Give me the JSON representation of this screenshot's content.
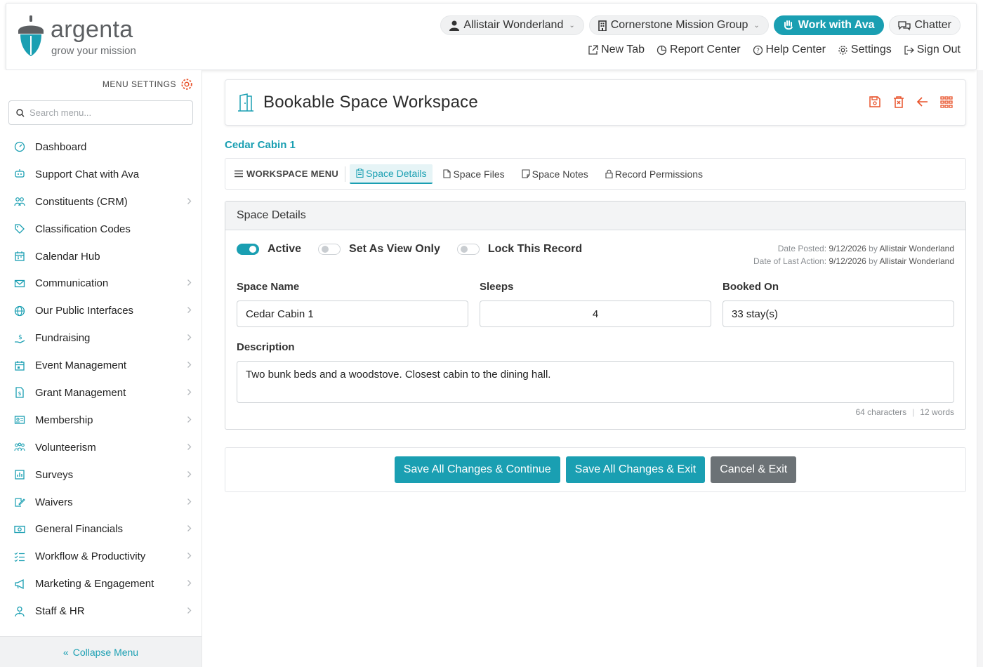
{
  "brand": {
    "name": "argenta",
    "tagline": "grow your mission",
    "accent": "#1a9fb2",
    "danger": "#e8532b"
  },
  "header": {
    "user": "Allistair Wonderland",
    "organization": "Cornerstone Mission Group",
    "ava_button": "Work with Ava",
    "chatter": "Chatter",
    "links": {
      "new_tab": "New Tab",
      "report_center": "Report Center",
      "help_center": "Help Center",
      "settings": "Settings",
      "sign_out": "Sign Out"
    }
  },
  "sidebar": {
    "menu_settings": "MENU SETTINGS",
    "search_placeholder": "Search menu...",
    "collapse": "Collapse Menu",
    "items": [
      {
        "label": "Dashboard",
        "icon": "dashboard-icon",
        "chevron": false
      },
      {
        "label": "Support Chat with Ava",
        "icon": "chat-robot-icon",
        "chevron": false
      },
      {
        "label": "Constituents (CRM)",
        "icon": "users-icon",
        "chevron": true
      },
      {
        "label": "Classification Codes",
        "icon": "tag-icon",
        "chevron": false
      },
      {
        "label": "Calendar Hub",
        "icon": "calendar-icon",
        "chevron": false
      },
      {
        "label": "Communication",
        "icon": "envelope-icon",
        "chevron": true
      },
      {
        "label": "Our Public Interfaces",
        "icon": "globe-icon",
        "chevron": true
      },
      {
        "label": "Fundraising",
        "icon": "donation-icon",
        "chevron": true
      },
      {
        "label": "Event Management",
        "icon": "event-icon",
        "chevron": true
      },
      {
        "label": "Grant Management",
        "icon": "grant-icon",
        "chevron": true
      },
      {
        "label": "Membership",
        "icon": "id-card-icon",
        "chevron": true
      },
      {
        "label": "Volunteerism",
        "icon": "volunteers-icon",
        "chevron": true
      },
      {
        "label": "Surveys",
        "icon": "survey-icon",
        "chevron": true
      },
      {
        "label": "Waivers",
        "icon": "signature-icon",
        "chevron": true
      },
      {
        "label": "General Financials",
        "icon": "money-icon",
        "chevron": true
      },
      {
        "label": "Workflow & Productivity",
        "icon": "checklist-icon",
        "chevron": true
      },
      {
        "label": "Marketing & Engagement",
        "icon": "megaphone-icon",
        "chevron": true
      },
      {
        "label": "Staff & HR",
        "icon": "staff-icon",
        "chevron": true
      }
    ]
  },
  "workspace": {
    "title": "Bookable Space Workspace",
    "record_name": "Cedar Cabin 1",
    "menu_label": "WORKSPACE MENU",
    "tabs": [
      {
        "label": "Space Details",
        "icon": "clipboard-icon",
        "active": true
      },
      {
        "label": "Space Files",
        "icon": "file-icon",
        "active": false
      },
      {
        "label": "Space Notes",
        "icon": "note-icon",
        "active": false
      },
      {
        "label": "Record Permissions",
        "icon": "lock-icon",
        "active": false
      }
    ]
  },
  "details": {
    "section_title": "Space Details",
    "toggles": {
      "active": {
        "label": "Active",
        "on": true
      },
      "view_only": {
        "label": "Set As View Only",
        "on": false
      },
      "lock": {
        "label": "Lock This Record",
        "on": false
      }
    },
    "meta": {
      "posted_label": "Date Posted:",
      "posted_date": "9/12/2026",
      "posted_by_word": "by",
      "posted_by": "Allistair Wonderland",
      "last_action_label": "Date of Last Action:",
      "last_action_date": "9/12/2026",
      "last_action_by_word": "by",
      "last_action_by": "Allistair Wonderland"
    },
    "fields": {
      "space_name": {
        "label": "Space Name",
        "value": "Cedar Cabin 1"
      },
      "sleeps": {
        "label": "Sleeps",
        "value": "4"
      },
      "booked_on": {
        "label": "Booked On",
        "value": "33 stay(s)"
      }
    },
    "description": {
      "label": "Description",
      "value": "Two bunk beds and a woodstove. Closest cabin to the dining hall.",
      "characters": "64 characters",
      "words": "12 words"
    }
  },
  "actions": {
    "save_continue": "Save All Changes & Continue",
    "save_exit": "Save All Changes & Exit",
    "cancel_exit": "Cancel & Exit"
  }
}
